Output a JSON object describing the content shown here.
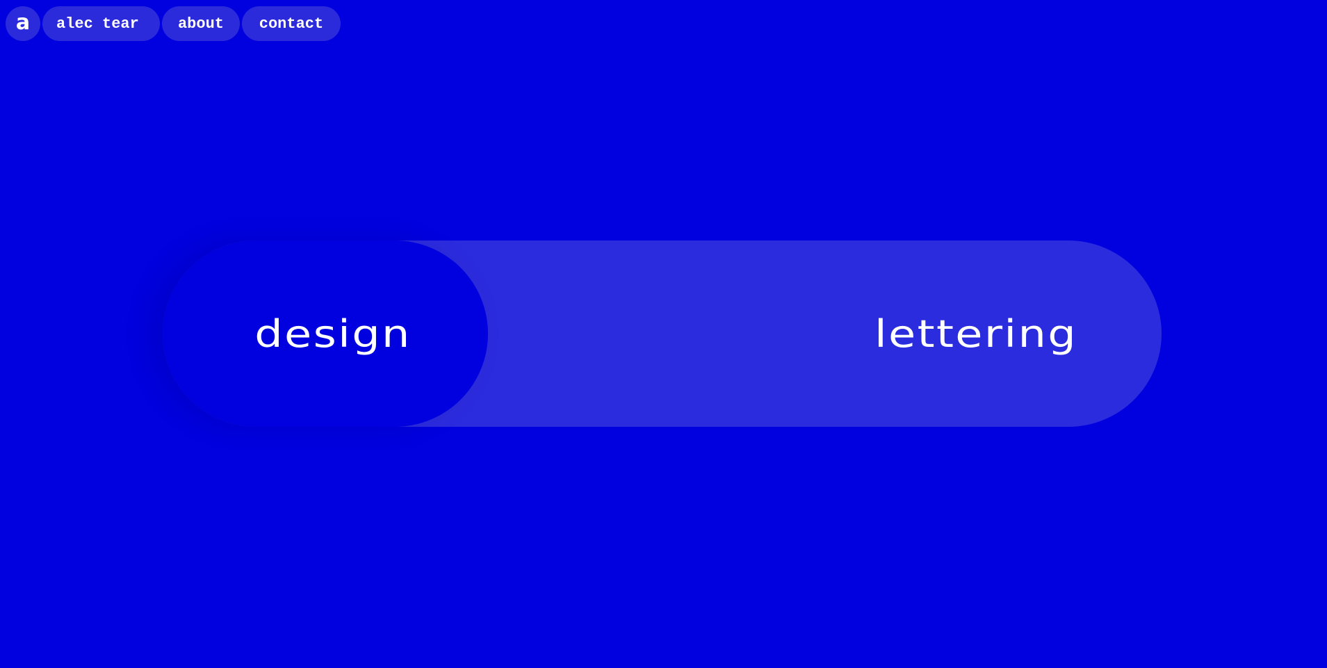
{
  "nav": {
    "logo_glyph": "a",
    "name_label": "alec tear",
    "about_label": "about",
    "contact_label": "contact"
  },
  "toggle": {
    "options": [
      {
        "label": "design",
        "selected": true
      },
      {
        "label": "lettering",
        "selected": false
      }
    ]
  },
  "colors": {
    "background": "#0101DF",
    "pill": "#2B2BDC",
    "track": "#2C2CDF",
    "text": "#FFFFFF"
  }
}
